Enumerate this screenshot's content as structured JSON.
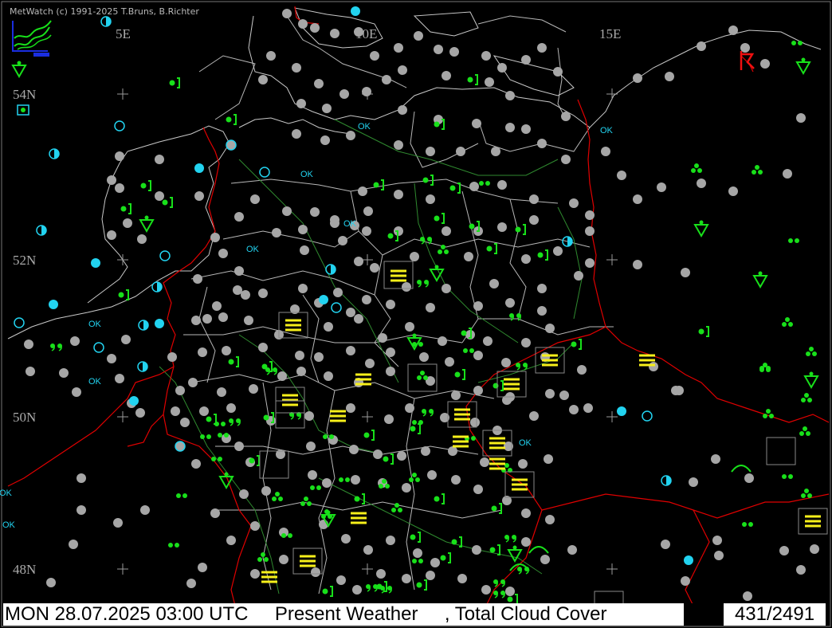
{
  "copyright": "MetWatch  (c) 1991-2025 T.Bruns, B.Richter",
  "status": {
    "main": "MON 28.07.2025 03:00 UTC     Present Weather     , Total Cloud Cover",
    "count": "431/2491"
  },
  "grid_labels": {
    "lon_5e": "5E",
    "lon_10e": "10E",
    "lon_15e": "15E",
    "lat_54n": "54N",
    "lat_52n": "52N",
    "lat_50n": "50N",
    "lat_48n": "48N"
  },
  "ok_label": "OK",
  "colors": {
    "background": "#000000",
    "borders": "#e00000",
    "coast": "#c8c8c8",
    "rivers": "#2f8a2f",
    "station_gray": "#a6a6a6",
    "station_cyan": "#22d3f0",
    "weather_green": "#18e01a",
    "fog_yellow": "#f7f01a",
    "thunder_red": "#f01010"
  },
  "icons": {
    "station": "circle-station-icon",
    "rain": "rain-dot-icon",
    "drizzle": "drizzle-comma-icon",
    "shower": "shower-triangle-icon",
    "fog": "fog-lines-icon",
    "mist": "mist-lines-icon",
    "thunder": "thunderstorm-icon"
  }
}
